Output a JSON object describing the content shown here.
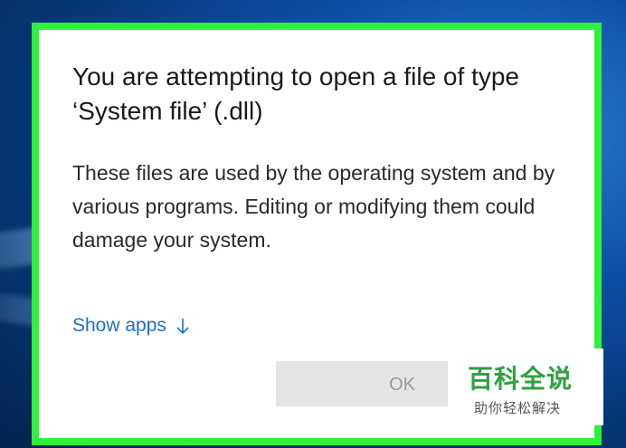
{
  "dialog": {
    "title": "You are attempting to open a file of type ‘System file’ (.dll)",
    "body": "These files are used by the operating system and by various programs. Editing or modifying them could damage your system.",
    "show_apps_label": "Show apps",
    "show_apps_icon": "arrow-down-icon",
    "ok_label": "OK"
  },
  "watermark": {
    "main": "百科全说",
    "sub": "助你轻松解决"
  },
  "colors": {
    "highlight": "#2ef13a",
    "link": "#1e6fc7",
    "watermark_green": "#2fa13f"
  }
}
